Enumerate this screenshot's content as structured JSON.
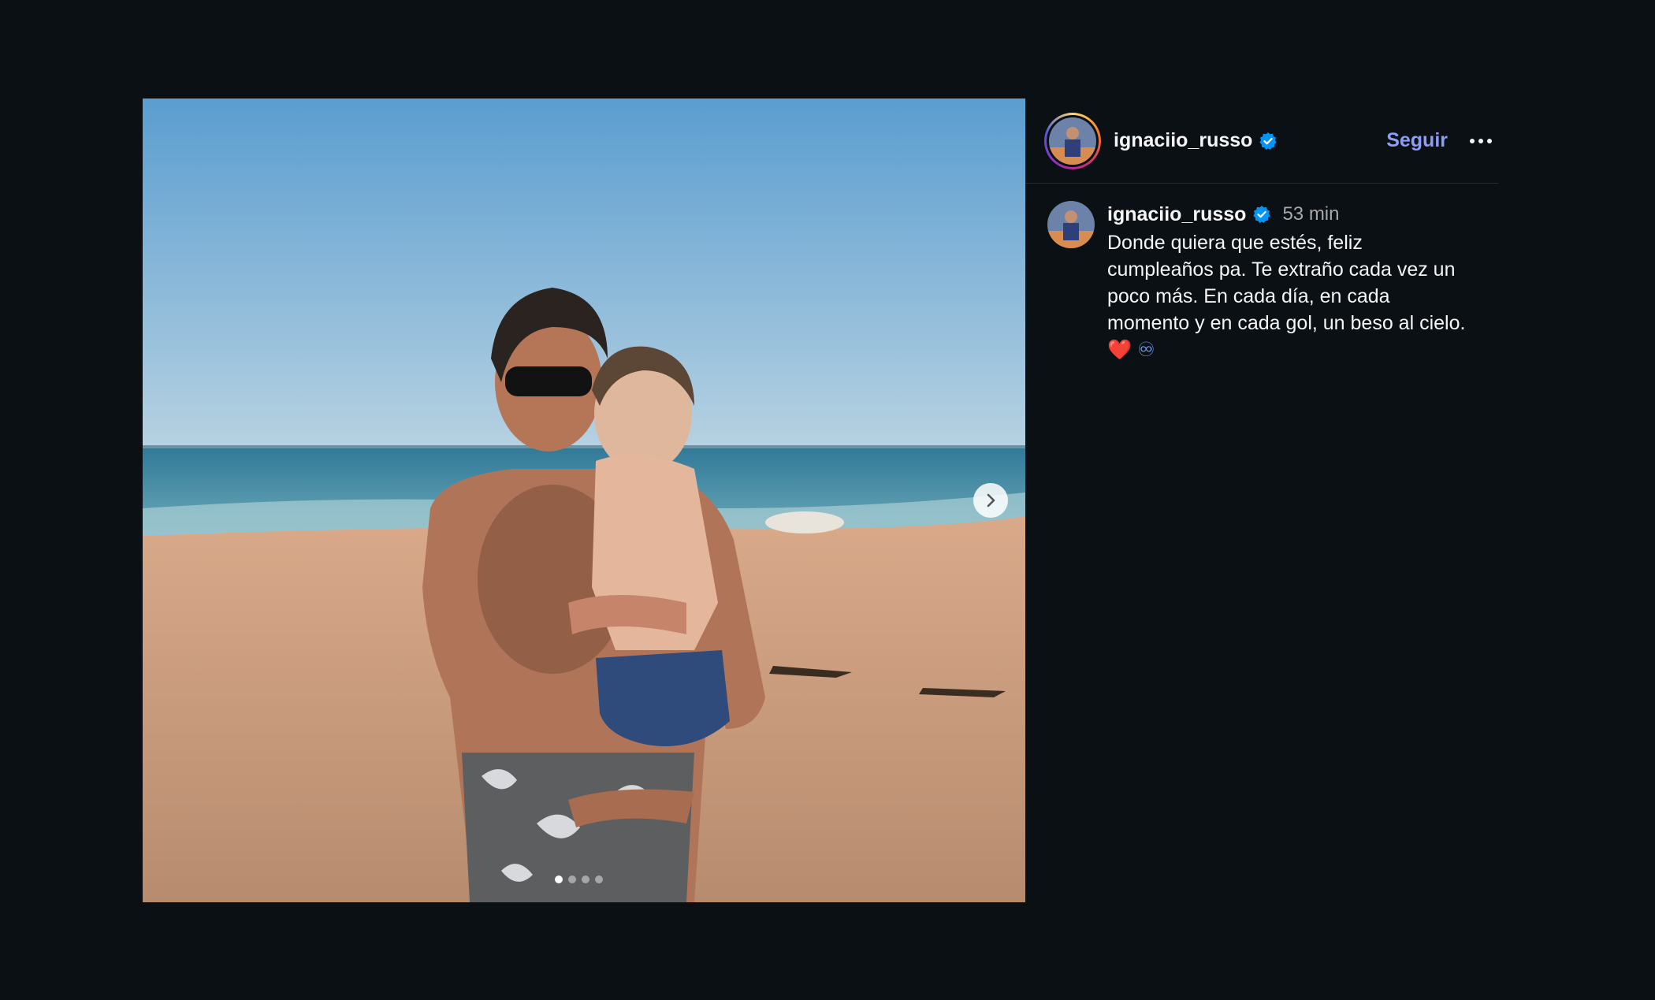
{
  "post": {
    "username": "ignaciio_russo",
    "follow_label": "Seguir",
    "time_ago": "53 min",
    "caption_text": "Donde quiera que estés, feliz cumpleaños pa. Te extraño cada vez un poco más. En cada día, en cada momento y en cada gol, un beso al cielo.",
    "caption_emoji_heart": "❤️",
    "caption_emoji_infinity": "♾",
    "carousel": {
      "total_slides": 4,
      "current_slide": 1
    }
  },
  "icons": {
    "verified": "verified-badge-icon",
    "more": "more-options-icon",
    "next": "chevron-right-icon"
  },
  "colors": {
    "background": "#0b1015",
    "follow": "#8c9df8",
    "verified": "#0095f6"
  }
}
